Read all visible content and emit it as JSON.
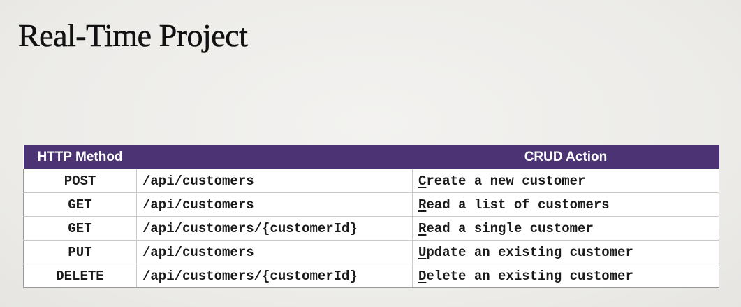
{
  "slide": {
    "title": "Real-Time Project"
  },
  "table": {
    "headers": {
      "method": "HTTP Method",
      "endpoint": "",
      "action": "CRUD Action"
    },
    "rows": [
      {
        "method": "POST",
        "endpoint": "/api/customers",
        "action_initial": "C",
        "action_rest": "reate a new customer"
      },
      {
        "method": "GET",
        "endpoint": "/api/customers",
        "action_initial": "R",
        "action_rest": "ead a list of customers"
      },
      {
        "method": "GET",
        "endpoint": "/api/customers/{customerId}",
        "action_initial": "R",
        "action_rest": "ead a single customer"
      },
      {
        "method": "PUT",
        "endpoint": "/api/customers",
        "action_initial": "U",
        "action_rest": "pdate an existing customer"
      },
      {
        "method": "DELETE",
        "endpoint": "/api/customers/{customerId}",
        "action_initial": "D",
        "action_rest": "elete an existing customer"
      }
    ]
  },
  "colors": {
    "header_bg": "#4c3474",
    "header_text": "#ffffff",
    "slide_bg": "#eeedeb"
  }
}
